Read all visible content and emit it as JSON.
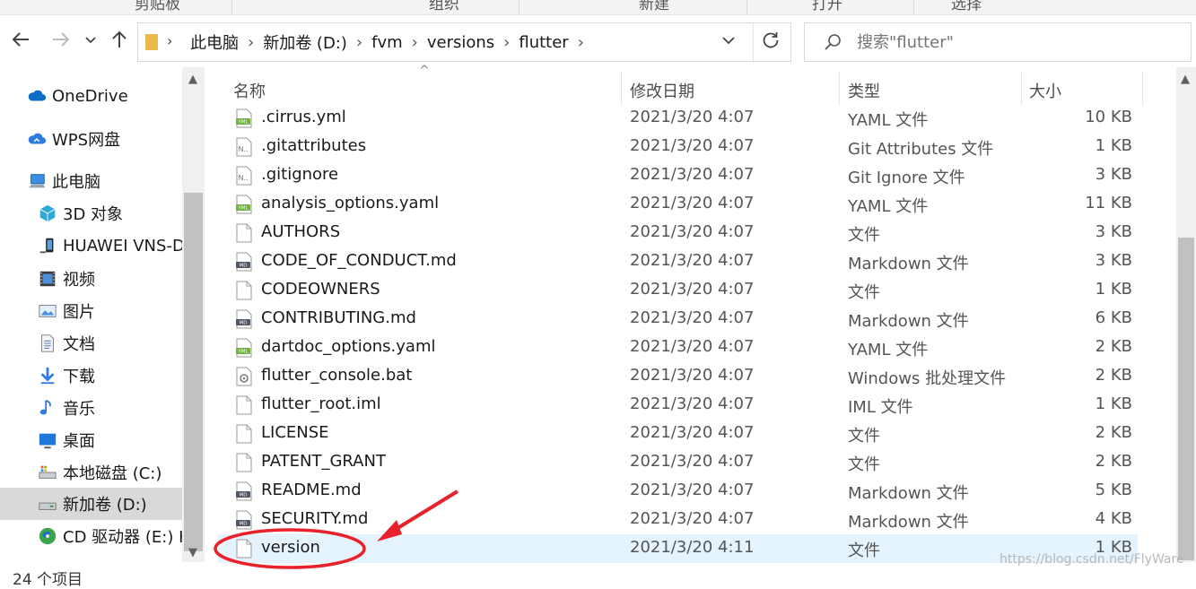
{
  "ribbon": {
    "groups": [
      "剪贴板",
      "组织",
      "新建",
      "打开",
      "选择"
    ]
  },
  "nav": {
    "back_icon": "arrow-left-icon",
    "forward_icon": "arrow-right-icon",
    "recent_icon": "chevron-down-icon",
    "up_icon": "arrow-up-icon"
  },
  "address": {
    "crumbs": [
      "此电脑",
      "新加卷 (D:)",
      "fvm",
      "versions",
      "flutter"
    ],
    "refresh_icon": "refresh-icon"
  },
  "search": {
    "placeholder": "搜索\"flutter\""
  },
  "sidebar": {
    "items": [
      {
        "label": "OneDrive",
        "icon": "onedrive-cloud-icon"
      },
      {
        "label": "WPS网盘",
        "icon": "wps-cloud-icon"
      },
      {
        "label": "此电脑",
        "icon": "this-pc-icon"
      },
      {
        "label": "3D 对象",
        "icon": "3d-objects-icon"
      },
      {
        "label": "HUAWEI VNS-D",
        "icon": "phone-device-icon"
      },
      {
        "label": "视频",
        "icon": "video-icon"
      },
      {
        "label": "图片",
        "icon": "pictures-icon"
      },
      {
        "label": "文档",
        "icon": "documents-icon"
      },
      {
        "label": "下载",
        "icon": "download-icon"
      },
      {
        "label": "音乐",
        "icon": "music-icon"
      },
      {
        "label": "桌面",
        "icon": "desktop-icon"
      },
      {
        "label": "本地磁盘 (C:)",
        "icon": "local-disk-icon"
      },
      {
        "label": "新加卷 (D:)",
        "icon": "drive-icon"
      },
      {
        "label": "CD 驱动器 (E:) H",
        "icon": "cd-drive-icon"
      }
    ],
    "selected_index": 12
  },
  "columns": {
    "name": "名称",
    "date": "修改日期",
    "type": "类型",
    "size": "大小"
  },
  "files": [
    {
      "name": ".cirrus.yml",
      "date": "2021/3/20 4:07",
      "type": "YAML 文件",
      "size": "10 KB",
      "icon": "yaml-file-icon"
    },
    {
      "name": ".gitattributes",
      "date": "2021/3/20 4:07",
      "type": "Git Attributes 文件",
      "size": "1 KB",
      "icon": "text-file-icon"
    },
    {
      "name": ".gitignore",
      "date": "2021/3/20 4:07",
      "type": "Git Ignore 文件",
      "size": "3 KB",
      "icon": "text-file-icon"
    },
    {
      "name": "analysis_options.yaml",
      "date": "2021/3/20 4:07",
      "type": "YAML 文件",
      "size": "11 KB",
      "icon": "yaml-file-icon"
    },
    {
      "name": "AUTHORS",
      "date": "2021/3/20 4:07",
      "type": "文件",
      "size": "3 KB",
      "icon": "blank-file-icon"
    },
    {
      "name": "CODE_OF_CONDUCT.md",
      "date": "2021/3/20 4:07",
      "type": "Markdown 文件",
      "size": "3 KB",
      "icon": "markdown-file-icon"
    },
    {
      "name": "CODEOWNERS",
      "date": "2021/3/20 4:07",
      "type": "文件",
      "size": "1 KB",
      "icon": "blank-file-icon"
    },
    {
      "name": "CONTRIBUTING.md",
      "date": "2021/3/20 4:07",
      "type": "Markdown 文件",
      "size": "6 KB",
      "icon": "markdown-file-icon"
    },
    {
      "name": "dartdoc_options.yaml",
      "date": "2021/3/20 4:07",
      "type": "YAML 文件",
      "size": "2 KB",
      "icon": "yaml-file-icon"
    },
    {
      "name": "flutter_console.bat",
      "date": "2021/3/20 4:07",
      "type": "Windows 批处理文件",
      "size": "2 KB",
      "icon": "batch-file-icon"
    },
    {
      "name": "flutter_root.iml",
      "date": "2021/3/20 4:07",
      "type": "IML 文件",
      "size": "1 KB",
      "icon": "blank-file-icon"
    },
    {
      "name": "LICENSE",
      "date": "2021/3/20 4:07",
      "type": "文件",
      "size": "2 KB",
      "icon": "blank-file-icon"
    },
    {
      "name": "PATENT_GRANT",
      "date": "2021/3/20 4:07",
      "type": "文件",
      "size": "2 KB",
      "icon": "blank-file-icon"
    },
    {
      "name": "README.md",
      "date": "2021/3/20 4:07",
      "type": "Markdown 文件",
      "size": "5 KB",
      "icon": "markdown-file-icon"
    },
    {
      "name": "SECURITY.md",
      "date": "2021/3/20 4:07",
      "type": "Markdown 文件",
      "size": "4 KB",
      "icon": "markdown-file-icon"
    },
    {
      "name": "version",
      "date": "2021/3/20 4:11",
      "type": "文件",
      "size": "1 KB",
      "icon": "blank-file-icon"
    }
  ],
  "selected_file_index": 15,
  "status": {
    "item_count": "24 个项目"
  },
  "watermark": "https://blog.csdn.net/FlyWare",
  "colors": {
    "selection": "#e5f3ff",
    "annotation": "#e8212a",
    "yaml_badge": "#6db33f",
    "folder": "#e9b949"
  }
}
